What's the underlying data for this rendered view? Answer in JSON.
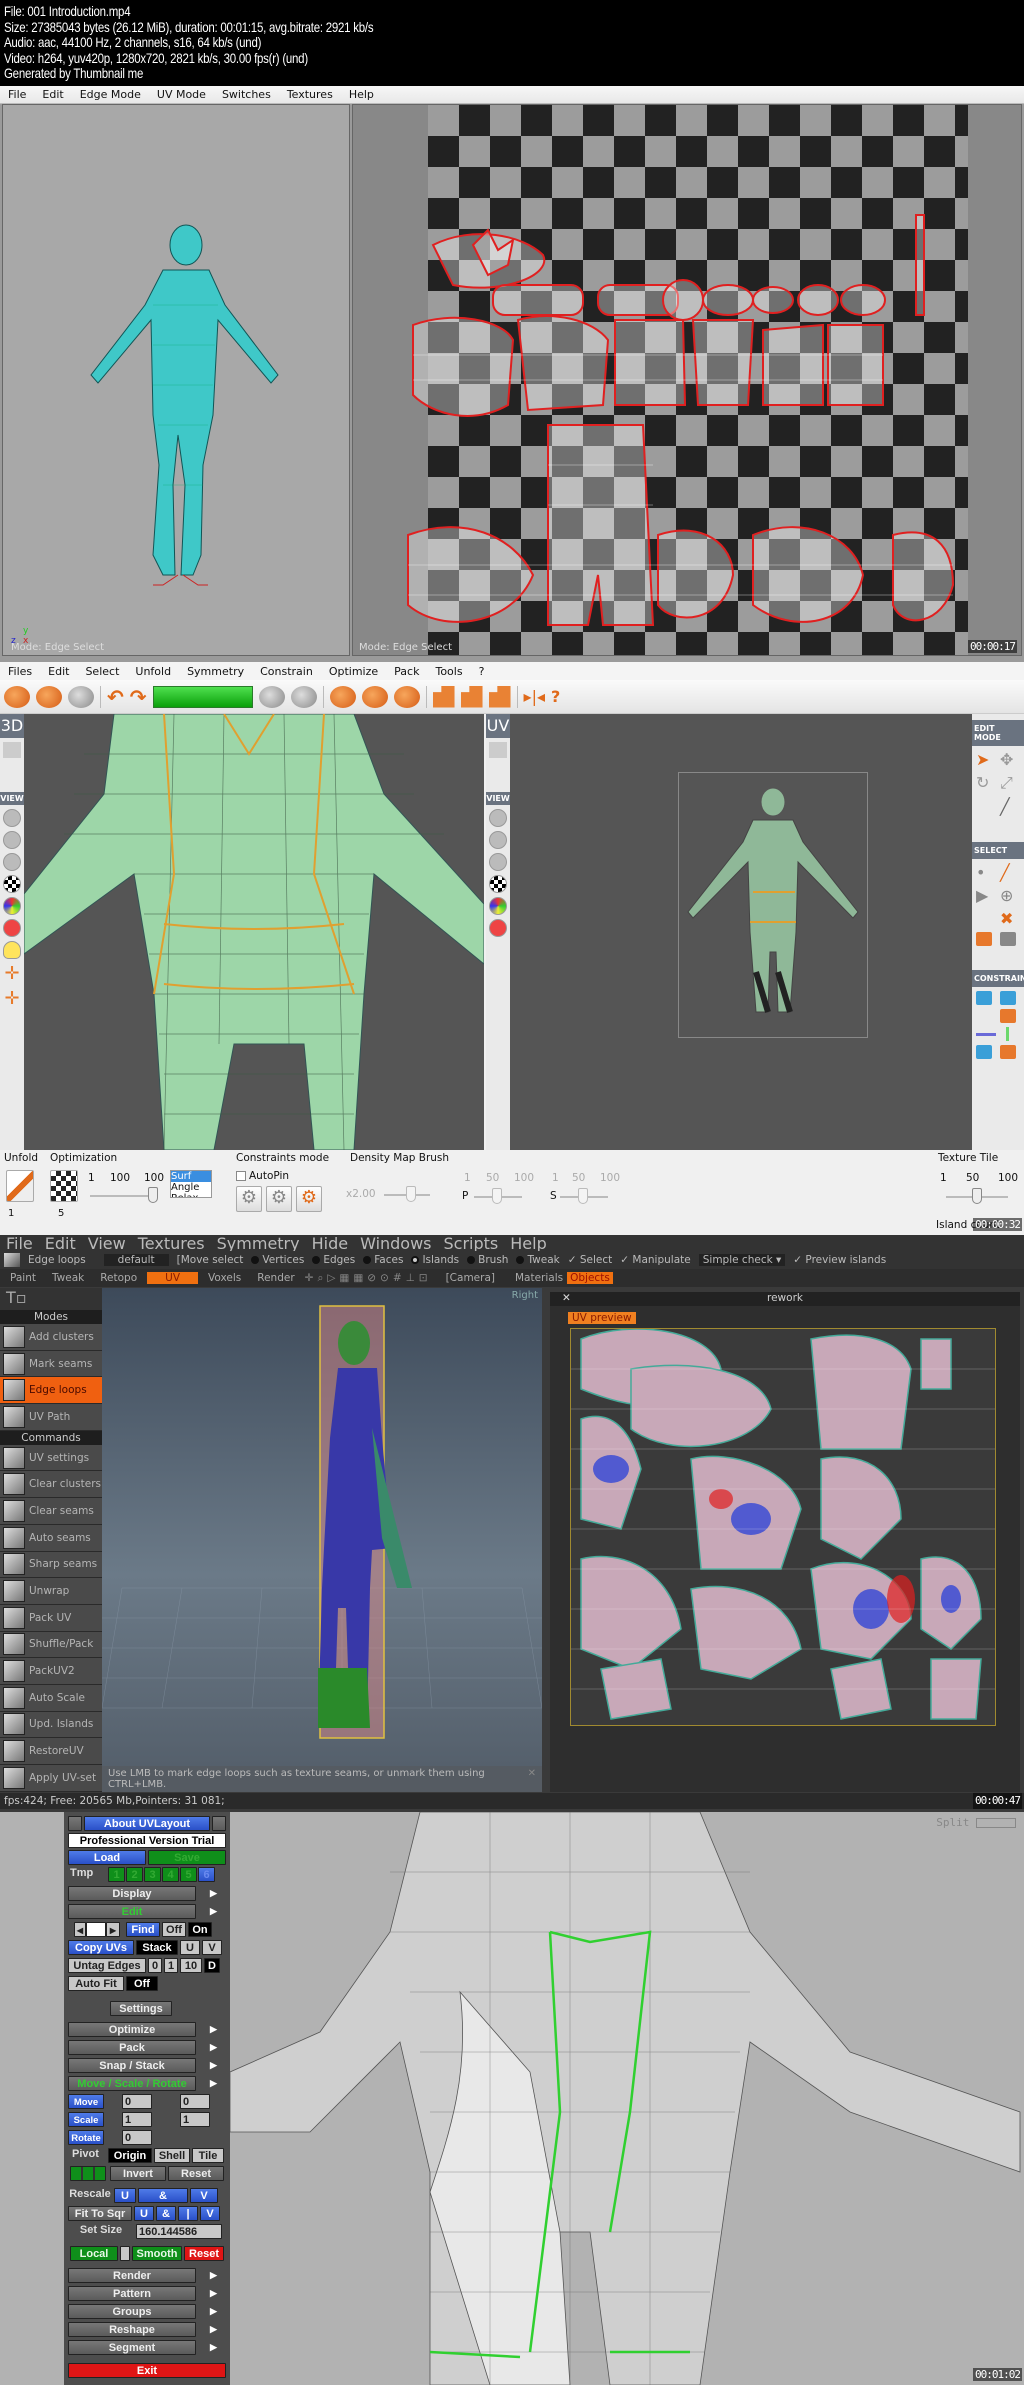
{
  "header": {
    "lines": [
      "File: 001 Introduction.mp4",
      "Size: 27385043 bytes (26.12 MiB), duration: 00:01:15, avg.bitrate: 2921 kb/s",
      "Audio: aac, 44100 Hz, 2 channels, s16, 64 kb/s (und)",
      "Video: h264, yuv420p, 1280x720, 2821 kb/s, 30.00 fps(r) (und)",
      "Generated by Thumbnail me"
    ]
  },
  "frame1": {
    "menu": [
      "File",
      "Edit",
      "Edge Mode",
      "UV Mode",
      "Switches",
      "Textures",
      "Help"
    ],
    "left_mode": "Mode: Edge Select",
    "right_mode": "Mode: Edge Select",
    "axis_labels": {
      "y": "y",
      "z": "z",
      "x": "x"
    },
    "timestamp": "00:00:17"
  },
  "frame2": {
    "menu": [
      "Files",
      "Edit",
      "Select",
      "Unfold",
      "Symmetry",
      "Constrain",
      "Optimize",
      "Pack",
      "Tools",
      "?"
    ],
    "view3d_tab": "3D",
    "viewuv_tab": "UV",
    "left_side_header": "VIEW",
    "right_panel": {
      "edit_mode": "EDIT MODE",
      "select": "SELECT",
      "constrain": "CONSTRAIN"
    },
    "bottom": {
      "unfold": {
        "title": "Unfold",
        "spin": "1"
      },
      "optimization": {
        "title": "Optimization",
        "ticks": [
          "1",
          "100",
          "100"
        ],
        "spin": "5",
        "list": [
          "Surf",
          "Angle",
          "Relax"
        ],
        "selected": "Surf"
      },
      "constraints": {
        "title": "Constraints mode",
        "autopin": "AutoPin",
        "autopin_checked": false
      },
      "density": {
        "title": "Density Map Brush",
        "value": "x2.00",
        "p_label": "P",
        "s_label": "S",
        "ticks": [
          "1",
          "50",
          "100"
        ]
      },
      "texture_tile": {
        "title": "Texture Tile",
        "ticks": [
          "1",
          "50",
          "100"
        ],
        "value": 50
      },
      "island_count": "Island count"
    },
    "timestamp": "00:00:32"
  },
  "frame3": {
    "menu": [
      "File",
      "Edit",
      "View",
      "Textures",
      "Symmetry",
      "Hide",
      "Windows",
      "Scripts",
      "Help"
    ],
    "tool_label": "Edge loops",
    "preset": "default",
    "move_select": "[Move select",
    "radios": [
      "Vertices",
      "Edges",
      "Faces",
      "Islands",
      "Brush",
      "Tweak"
    ],
    "selected_radio": "Islands",
    "checks": [
      "Select",
      "Manipulate"
    ],
    "simple_check": "Simple check",
    "preview_islands": "Preview islands",
    "rooms": [
      "Paint",
      "Tweak",
      "Retopo",
      "UV",
      "Voxels",
      "Render"
    ],
    "active_room": "UV",
    "camera": "[Camera]",
    "panel_tabs": [
      "Materials",
      "Objects"
    ],
    "active_panel_tab": "Objects",
    "rework_title": "rework",
    "uv_preview": "UV preview",
    "view_label": "Right",
    "sidebar": {
      "modes_header": "Modes",
      "modes": [
        "Add clusters",
        "Mark seams",
        "Edge loops",
        "UV Path"
      ],
      "active_mode": "Edge loops",
      "commands_header": "Commands",
      "commands": [
        "UV settings",
        "Clear clusters",
        "Clear seams",
        "Auto seams",
        "Sharp seams",
        "Unwrap",
        "Pack UV",
        "Shuffle/Pack",
        "PackUV2",
        "Auto Scale",
        "Upd. Islands",
        "RestoreUV",
        "Apply UV-set"
      ]
    },
    "hint": "Use LMB to mark edge loops such as texture seams, or unmark them using CTRL+LMB.",
    "status": "fps:424;   Free: 20565 Mb,Pointers: 31 081;",
    "timestamp": "00:00:47"
  },
  "frame4": {
    "about": "About UVLayout",
    "version": "Professional Version Trial",
    "load": "Load",
    "save": "Save",
    "tmp": "Tmp",
    "tmp_slots": [
      "1",
      "2",
      "3",
      "4",
      "5",
      "6"
    ],
    "display": "Display",
    "edit": "Edit",
    "find": "Find",
    "off": "Off",
    "on": "On",
    "copy_uvs": "Copy UVs",
    "stack": "Stack",
    "u": "U",
    "v": "V",
    "untag_edges": "Untag Edges",
    "untag_vals": [
      "0",
      "1",
      "10",
      "D"
    ],
    "auto_fit": "Auto Fit",
    "auto_fit_state": "Off",
    "settings": "Settings",
    "menu_items": [
      "Optimize",
      "Pack",
      "Snap / Stack",
      "Move / Scale / Rotate"
    ],
    "move": "Move",
    "scale": "Scale",
    "rotate": "Rotate",
    "move_vals": [
      "0",
      "0"
    ],
    "scale_vals": [
      "1",
      "1"
    ],
    "rotate_val": "0",
    "pivot": "Pivot",
    "pivot_opts": [
      "Origin",
      "Shell",
      "Tile"
    ],
    "invert": "Invert",
    "reset": "Reset",
    "rescale": "Rescale",
    "amp": "&",
    "fit_to_sqr": "Fit To Sqr",
    "bar": "|",
    "set_size": "Set Size",
    "set_size_val": "160.144586",
    "local": "Local",
    "smooth": "Smooth",
    "reset_red": "Reset",
    "menu_items2": [
      "Render",
      "Pattern",
      "Groups",
      "Reshape",
      "Segment"
    ],
    "exit": "Exit",
    "split": "Split",
    "timestamp": "00:01:02"
  },
  "colors": {
    "orange": "#f07010",
    "uvblue": "#2a50c8",
    "uvgreen": "#0f8f1a",
    "exitred": "#e01515"
  }
}
